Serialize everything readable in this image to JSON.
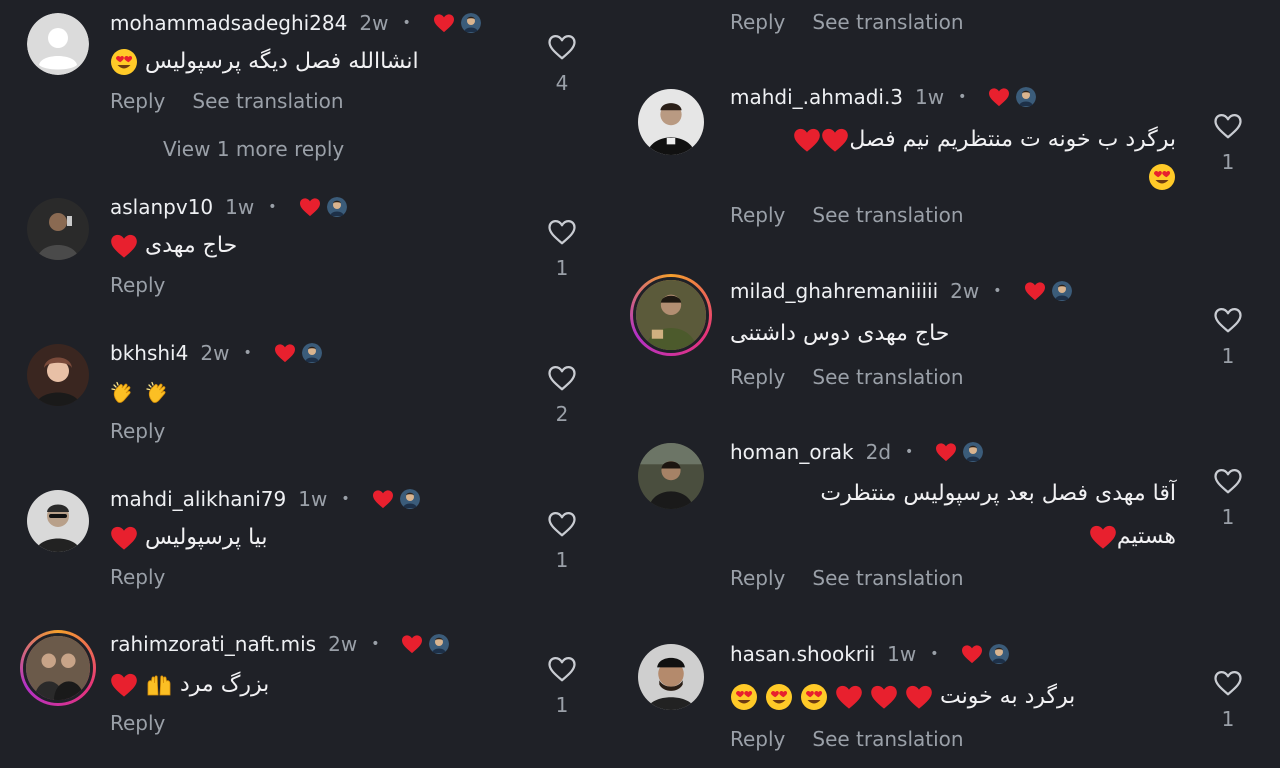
{
  "colors": {
    "background": "#1f2127",
    "text": "#f1f1f3",
    "muted": "#9aa0a8",
    "heart": "#e8202e"
  },
  "labels": {
    "reply": "Reply",
    "see_translation": "See translation"
  },
  "top_partial": {
    "reply": "Reply",
    "see_translation": "See translation"
  },
  "comments": [
    {
      "username": "mohammadsadeghi284",
      "time": "2w",
      "text": "انشاالله فصل دیگه پرسپولیس",
      "likes": "4",
      "reply": "Reply",
      "see_translation": "See translation",
      "view_more": "View 1 more reply"
    },
    {
      "username": "aslanpv10",
      "time": "1w",
      "text": "حاج مهدی",
      "likes": "1",
      "reply": "Reply"
    },
    {
      "username": "bkhshi4",
      "time": "2w",
      "text": "",
      "likes": "2",
      "reply": "Reply"
    },
    {
      "username": "mahdi_alikhani79",
      "time": "1w",
      "text": "بیا پرسپولیس",
      "likes": "1",
      "reply": "Reply"
    },
    {
      "username": "rahimzorati_naft.mis",
      "time": "2w",
      "text": "بزرگ مرد",
      "likes": "1",
      "reply": "Reply"
    },
    {
      "username": "mahdi_.ahmadi.3",
      "time": "1w",
      "text": "برگرد ب خونه ت منتظریم نیم فصل",
      "likes": "1",
      "reply": "Reply",
      "see_translation": "See translation"
    },
    {
      "username": "milad_ghahremaniiiii",
      "time": "2w",
      "text": "حاج مهدی دوس داشتنی",
      "likes": "1",
      "reply": "Reply",
      "see_translation": "See translation"
    },
    {
      "username": "homan_orak",
      "time": "2d",
      "text_line1": "آقا مهدی فصل بعد پرسپولیس منتظرت",
      "text_line2": "هستیم",
      "likes": "1",
      "reply": "Reply",
      "see_translation": "See translation"
    },
    {
      "username": "hasan.shookrii",
      "time": "1w",
      "text": "برگرد به خونت",
      "likes": "1",
      "reply": "Reply",
      "see_translation": "See translation"
    }
  ]
}
